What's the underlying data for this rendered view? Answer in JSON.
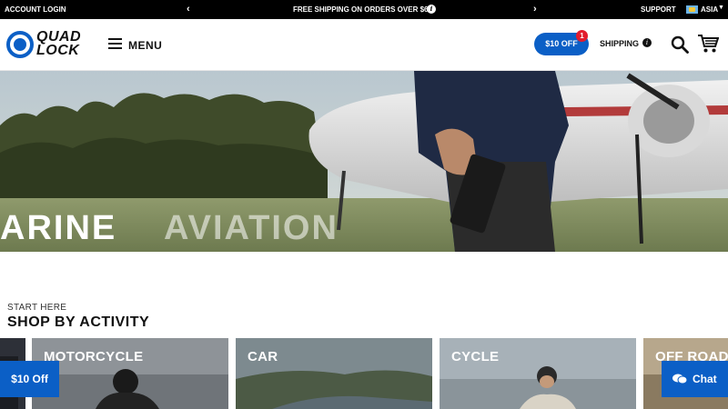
{
  "topbar": {
    "account_login": "ACCOUNT LOGIN",
    "prev_icon": "chevron-left-icon",
    "promo_text": "FREE SHIPPING ON ORDERS OVER $69",
    "info_icon": "info-icon",
    "info_glyph": "i",
    "next_icon": "chevron-right-icon",
    "support": "SUPPORT",
    "region": "ASIA",
    "flag_icon": "flag-icon"
  },
  "header": {
    "logo_line1": "QUAD",
    "logo_line2": "LOCK",
    "menu_label": "MENU",
    "discount_label": "$10 OFF",
    "discount_badge": "1",
    "shipping_label": "SHIPPING",
    "shipping_info_glyph": "i"
  },
  "hero": {
    "slide_text_current": "ARINE",
    "slide_text_next": "AVIATION"
  },
  "activity": {
    "eyebrow": "START HERE",
    "title": "SHOP BY ACTIVITY",
    "cards": [
      {
        "label": "MOTORCYCLE"
      },
      {
        "label": "CAR"
      },
      {
        "label": "CYCLE"
      },
      {
        "label": "OFF ROAD"
      }
    ]
  },
  "floating": {
    "discount_tab": "$10 Off",
    "chat_label": "Chat"
  },
  "colors": {
    "brand_blue": "#0b5fc6",
    "badge_red": "#e21b2d",
    "topbar_bg": "#000000"
  }
}
